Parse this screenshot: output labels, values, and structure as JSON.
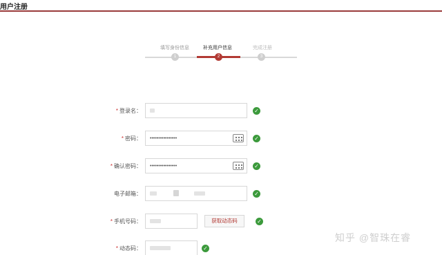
{
  "header": {
    "title": "用户注册"
  },
  "steps": [
    {
      "label": "填写身份信息",
      "number": "1",
      "state": "done"
    },
    {
      "label": "补充用户信息",
      "number": "2",
      "state": "active"
    },
    {
      "label": "完成注册",
      "number": "3",
      "state": "todo"
    }
  ],
  "form": {
    "login_name": {
      "label": "登录名：",
      "required": "*",
      "value": ""
    },
    "password": {
      "label": "密码：",
      "required": "*",
      "value": "••••••••••••••••"
    },
    "confirm_password": {
      "label": "确认密码：",
      "required": "*",
      "value": "••••••••••••••••"
    },
    "email": {
      "label": "电子邮箱：",
      "value": ""
    },
    "phone": {
      "label": "手机号码：",
      "required": "*",
      "value": ""
    },
    "get_code_button": "获取动态码",
    "dynamic_code": {
      "label": "动态码：",
      "required": "*",
      "value": ""
    }
  },
  "check_glyph": "✓",
  "watermark": "知乎 @智珠在睿",
  "colors": {
    "accent": "#b23a34",
    "success": "#3c9a3c",
    "border": "#d7d7d7"
  }
}
